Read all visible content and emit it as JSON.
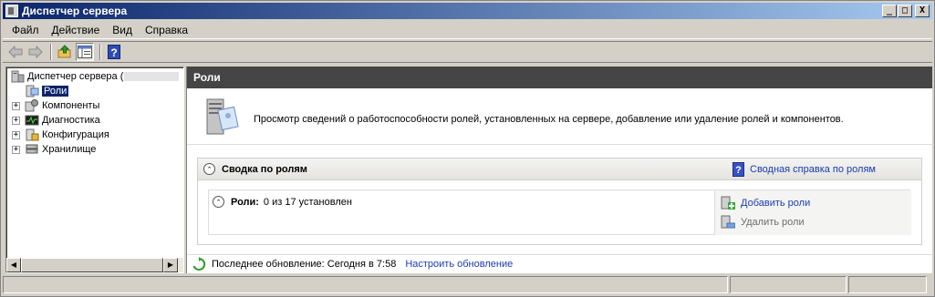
{
  "window": {
    "title": "Диспетчер сервера",
    "minimize": "_",
    "maximize": "□",
    "close": "X"
  },
  "menu": [
    "Файл",
    "Действие",
    "Вид",
    "Справка"
  ],
  "toolbar": {
    "help_glyph": "?"
  },
  "tree": {
    "root": "Диспетчер сервера (",
    "items": [
      {
        "label": "Роли",
        "selected": true,
        "expandable": false
      },
      {
        "label": "Компоненты",
        "expandable": true
      },
      {
        "label": "Диагностика",
        "expandable": true
      },
      {
        "label": "Конфигурация",
        "expandable": true
      },
      {
        "label": "Хранилище",
        "expandable": true
      }
    ],
    "expander_glyph": "+"
  },
  "main": {
    "header": "Роли",
    "description": "Просмотр сведений о работоспособности ролей, установленных на сервере, добавление или удаление ролей и компонентов.",
    "summary": {
      "title": "Сводка по ролям",
      "help_link": "Сводная справка по ролям",
      "help_glyph": "?",
      "roles_label": "Роли:",
      "roles_value": "0 из 17 установлен",
      "actions": {
        "add": "Добавить роли",
        "remove": "Удалить роли"
      }
    },
    "footer": {
      "last_update": "Последнее обновление: Сегодня в 7:58",
      "configure_link": "Настроить обновление"
    }
  },
  "colors": {
    "title_gradient_start": "#0a246a",
    "title_gradient_end": "#a6caf0",
    "link": "#1a3cb2",
    "header_bg": "#454545"
  }
}
